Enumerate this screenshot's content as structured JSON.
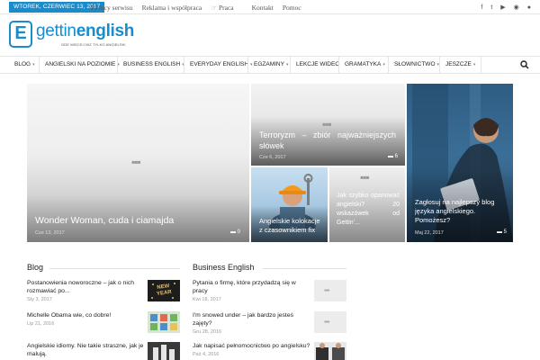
{
  "topbar": {
    "date": "WTOREK, CZERWIEC 13, 2017",
    "links": [
      "Twórcy serwisu",
      "Reklama i współpraca",
      "Praca",
      "Kontakt",
      "Pomoc"
    ],
    "social_icons": [
      "facebook-icon",
      "twitter-icon",
      "youtube-icon",
      "instagram-icon",
      "rss-icon"
    ],
    "social_glyphs": [
      "f",
      "t",
      "▶",
      "◉",
      "●"
    ]
  },
  "logo": {
    "mark": "E",
    "text_light": "gettin",
    "text_bold": "english",
    "tagline": "GDE WIĘCEJ NIŻ TYLKO ANGIELSKI"
  },
  "nav": {
    "items": [
      "BLOG",
      "ANGIELSKI NA POZIOMIE",
      "BUSINESS ENGLISH",
      "EVERYDAY ENGLISH",
      "EGZAMINY",
      "LEKCJE WIDEO",
      "GRAMATYKA",
      "SŁOWNICTWO",
      "JESZCZE"
    ],
    "dropdown": [
      true,
      true,
      true,
      true,
      true,
      false,
      true,
      true,
      true
    ]
  },
  "featured": {
    "main": {
      "title": "Wonder Woman, cuda i ciamajda",
      "date": "Cze 13, 2017",
      "comments": "0"
    },
    "top": {
      "title": "Terroryzm – zbiór najważniejszych słówek",
      "date": "Cze 6, 2017",
      "comments": "6"
    },
    "mid_left": {
      "title": "Angielskie kolokacje z czasownikiem fix"
    },
    "mid_right": {
      "title": "Jak szybko opanować angielski? 20 wskazówek od Gettin'..."
    },
    "right": {
      "title": "Zagłosuj na najlepszy blog języka angielskiego. Pomożesz?",
      "date": "Maj 22, 2017",
      "comments": "5"
    }
  },
  "blog": {
    "heading": "Blog",
    "posts": [
      {
        "title": "Postanowienia noworoczne – jak o nich rozmawiać po...",
        "date": "Sty 3, 2017"
      },
      {
        "title": "Michelle Obama wie, co dobre!",
        "date": "Lip 21, 2016"
      },
      {
        "title": "Angielskie idiomy. Nie takie straszne, jak je malują.",
        "date": ""
      }
    ],
    "thumb_text": "NEW YEAR"
  },
  "business": {
    "heading": "Business English",
    "posts": [
      {
        "title": "Pytania o firmę, które przydadzą się w pracy",
        "date": "Kwi 18, 2017"
      },
      {
        "title": "I'm snowed under – jak bardzo jesteś zajęty?",
        "date": "Gru 28, 2016"
      },
      {
        "title": "Jak napisać pełnomocnictwo po angielsku?",
        "date": "Paź 4, 2016"
      }
    ]
  },
  "colors": {
    "accent": "#1a8ccc"
  }
}
